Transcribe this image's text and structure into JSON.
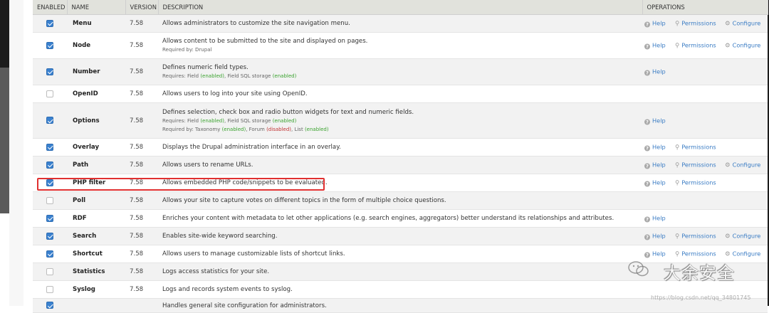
{
  "header": {
    "enabled": "ENABLED",
    "name": "NAME",
    "version": "VERSION",
    "description": "DESCRIPTION",
    "operations": "OPERATIONS"
  },
  "op_labels": {
    "help": "Help",
    "permissions": "Permissions",
    "configure": "Configure"
  },
  "modules": [
    {
      "enabled": true,
      "name": "Menu",
      "version": "7.58",
      "description": "Allows administrators to customize the site navigation menu.",
      "ops": [
        "help",
        "permissions",
        "configure"
      ]
    },
    {
      "enabled": true,
      "name": "Node",
      "version": "7.58",
      "description": "Allows content to be submitted to the site and displayed on pages.",
      "requires": "",
      "required_by": "Required by: Drupal",
      "ops": [
        "help",
        "permissions",
        "configure"
      ]
    },
    {
      "enabled": true,
      "name": "Number",
      "version": "7.58",
      "description": "Defines numeric field types.",
      "requires_text": "Requires: Field (enabled), Field SQL storage (enabled)",
      "ops": [
        "help"
      ]
    },
    {
      "enabled": false,
      "name": "OpenID",
      "version": "7.58",
      "description": "Allows users to log into your site using OpenID.",
      "ops": []
    },
    {
      "enabled": true,
      "name": "Options",
      "version": "7.58",
      "description": "Defines selection, check box and radio button widgets for text and numeric fields.",
      "requires_text": "Requires: Field (enabled), Field SQL storage (enabled)",
      "required_by_text": "Required by: Taxonomy (enabled), Forum (disabled), List (enabled)",
      "ops": [
        "help"
      ]
    },
    {
      "enabled": true,
      "name": "Overlay",
      "version": "7.58",
      "description": "Displays the Drupal administration interface in an overlay.",
      "ops": [
        "help",
        "permissions"
      ]
    },
    {
      "enabled": true,
      "name": "Path",
      "version": "7.58",
      "description": "Allows users to rename URLs.",
      "ops": [
        "help",
        "permissions",
        "configure"
      ]
    },
    {
      "enabled": true,
      "name": "PHP filter",
      "version": "7.58",
      "description": "Allows embedded PHP code/snippets to be evaluated.",
      "ops": [
        "help",
        "permissions"
      ]
    },
    {
      "enabled": false,
      "name": "Poll",
      "version": "7.58",
      "description": "Allows your site to capture votes on different topics in the form of multiple choice questions.",
      "ops": []
    },
    {
      "enabled": true,
      "name": "RDF",
      "version": "7.58",
      "description": "Enriches your content with metadata to let other applications (e.g. search engines, aggregators) better understand its relationships and attributes.",
      "ops": [
        "help"
      ]
    },
    {
      "enabled": true,
      "name": "Search",
      "version": "7.58",
      "description": "Enables site-wide keyword searching.",
      "ops": [
        "help",
        "permissions",
        "configure"
      ]
    },
    {
      "enabled": true,
      "name": "Shortcut",
      "version": "7.58",
      "description": "Allows users to manage customizable lists of shortcut links.",
      "ops": [
        "help",
        "permissions",
        "configure"
      ]
    },
    {
      "enabled": false,
      "name": "Statistics",
      "version": "7.58",
      "description": "Logs access statistics for your site.",
      "ops": []
    },
    {
      "enabled": false,
      "name": "Syslog",
      "version": "7.58",
      "description": "Logs and records system events to syslog.",
      "ops": []
    },
    {
      "enabled": true,
      "name": "",
      "version": "",
      "description": "Handles general site configuration for administrators.",
      "ops": []
    }
  ],
  "watermark": {
    "brand": "大余安全",
    "url": "https://blog.csdn.net/qq_34801745"
  },
  "colors": {
    "accent": "#3a81cf",
    "link": "#3a7cc4",
    "enabled": "#3aa22e",
    "disabled": "#c03030",
    "highlight": "#e03030"
  }
}
